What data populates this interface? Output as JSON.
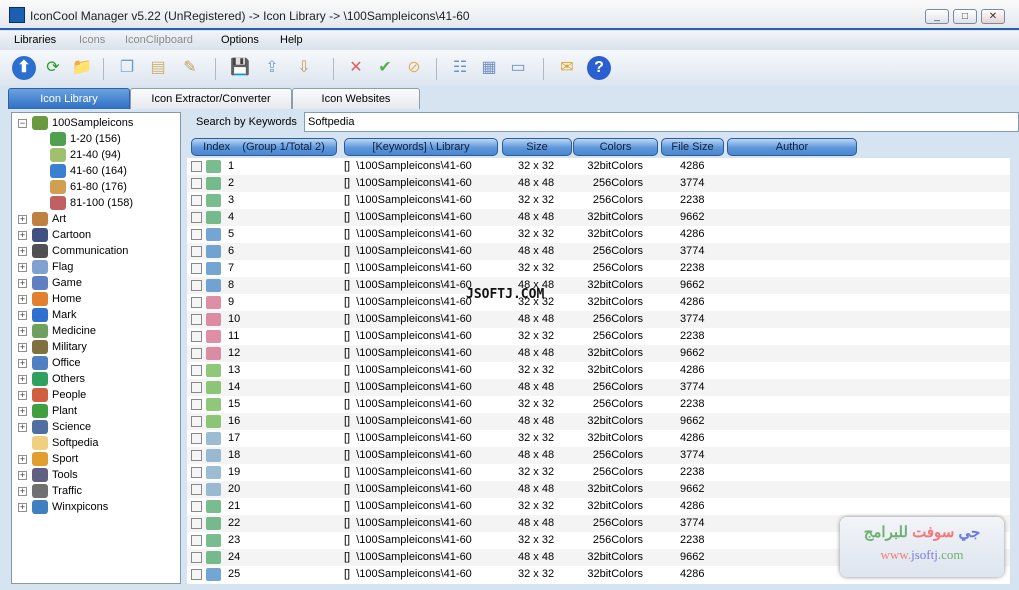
{
  "window": {
    "title": "IconCool Manager v5.22 (UnRegistered) -> Icon Library -> \\100Sampleicons\\41-60"
  },
  "menu": [
    {
      "label": "Libraries",
      "enabled": true
    },
    {
      "label": "Icons",
      "enabled": false
    },
    {
      "label": "IconClipboard",
      "enabled": false
    },
    {
      "label": "Options",
      "enabled": true
    },
    {
      "label": "Help",
      "enabled": true
    }
  ],
  "toolbar": [
    "up-arrow-icon",
    "refresh-icon",
    "new-folder-icon",
    "copy-icon",
    "paste-icon",
    "edit-icon",
    "save-icon",
    "export-icon",
    "import-icon",
    "delete-icon",
    "check-icon",
    "disable-icon",
    "list-view-icon",
    "grid-view-icon",
    "detail-view-icon",
    "email-icon",
    "help-icon"
  ],
  "tabs": [
    {
      "label": "Icon Library",
      "active": true
    },
    {
      "label": "Icon Extractor/Converter",
      "active": false
    },
    {
      "label": "Icon Websites",
      "active": false
    }
  ],
  "tree": {
    "root": "100Sampleicons",
    "children": [
      "1-20 (156)",
      "21-40 (94)",
      "41-60 (164)",
      "61-80 (176)",
      "81-100 (158)"
    ],
    "categories": [
      "Art",
      "Cartoon",
      "Communication",
      "Flag",
      "Game",
      "Home",
      "Mark",
      "Medicine",
      "Military",
      "Office",
      "Others",
      "People",
      "Plant",
      "Science",
      "Softpedia",
      "Sport",
      "Tools",
      "Traffic",
      "Winxpicons"
    ]
  },
  "search": {
    "label": "Search by Keywords",
    "value": "Softpedia"
  },
  "columns": [
    "Index    (Group 1/Total 2)",
    "[Keywords] \\ Library",
    "Size",
    "Colors",
    "File Size",
    "Author"
  ],
  "rows": [
    [
      "1",
      "[]  \\100Sampleicons\\41-60",
      "32 x 32",
      "32bitColors",
      "4286"
    ],
    [
      "2",
      "[]  \\100Sampleicons\\41-60",
      "48 x 48",
      "256Colors",
      "3774"
    ],
    [
      "3",
      "[]  \\100Sampleicons\\41-60",
      "32 x 32",
      "256Colors",
      "2238"
    ],
    [
      "4",
      "[]  \\100Sampleicons\\41-60",
      "48 x 48",
      "32bitColors",
      "9662"
    ],
    [
      "5",
      "[]  \\100Sampleicons\\41-60",
      "32 x 32",
      "32bitColors",
      "4286"
    ],
    [
      "6",
      "[]  \\100Sampleicons\\41-60",
      "48 x 48",
      "256Colors",
      "3774"
    ],
    [
      "7",
      "[]  \\100Sampleicons\\41-60",
      "32 x 32",
      "256Colors",
      "2238"
    ],
    [
      "8",
      "[]  \\100Sampleicons\\41-60",
      "48 x 48",
      "32bitColors",
      "9662"
    ],
    [
      "9",
      "[]  \\100Sampleicons\\41-60",
      "32 x 32",
      "32bitColors",
      "4286"
    ],
    [
      "10",
      "[]  \\100Sampleicons\\41-60",
      "48 x 48",
      "256Colors",
      "3774"
    ],
    [
      "11",
      "[]  \\100Sampleicons\\41-60",
      "32 x 32",
      "256Colors",
      "2238"
    ],
    [
      "12",
      "[]  \\100Sampleicons\\41-60",
      "48 x 48",
      "32bitColors",
      "9662"
    ],
    [
      "13",
      "[]  \\100Sampleicons\\41-60",
      "32 x 32",
      "32bitColors",
      "4286"
    ],
    [
      "14",
      "[]  \\100Sampleicons\\41-60",
      "48 x 48",
      "256Colors",
      "3774"
    ],
    [
      "15",
      "[]  \\100Sampleicons\\41-60",
      "32 x 32",
      "256Colors",
      "2238"
    ],
    [
      "16",
      "[]  \\100Sampleicons\\41-60",
      "48 x 48",
      "32bitColors",
      "9662"
    ],
    [
      "17",
      "[]  \\100Sampleicons\\41-60",
      "32 x 32",
      "32bitColors",
      "4286"
    ],
    [
      "18",
      "[]  \\100Sampleicons\\41-60",
      "48 x 48",
      "256Colors",
      "3774"
    ],
    [
      "19",
      "[]  \\100Sampleicons\\41-60",
      "32 x 32",
      "256Colors",
      "2238"
    ],
    [
      "20",
      "[]  \\100Sampleicons\\41-60",
      "48 x 48",
      "32bitColors",
      "9662"
    ],
    [
      "21",
      "[]  \\100Sampleicons\\41-60",
      "32 x 32",
      "32bitColors",
      "4286"
    ],
    [
      "22",
      "[]  \\100Sampleicons\\41-60",
      "48 x 48",
      "256Colors",
      "3774"
    ],
    [
      "23",
      "[]  \\100Sampleicons\\41-60",
      "32 x 32",
      "256Colors",
      "2238"
    ],
    [
      "24",
      "[]  \\100Sampleicons\\41-60",
      "48 x 48",
      "32bitColors",
      "9662"
    ],
    [
      "25",
      "[]  \\100Sampleicons\\41-60",
      "32 x 32",
      "32bitColors",
      "4286"
    ]
  ],
  "overlay_text": "JSOFTJ.COM",
  "watermark": {
    "arabic": "جي سوفت للبرامج",
    "url": "www.jsoftj.com"
  },
  "colors": {
    "accent": "#2f6fc2",
    "header": "#5d97db"
  }
}
